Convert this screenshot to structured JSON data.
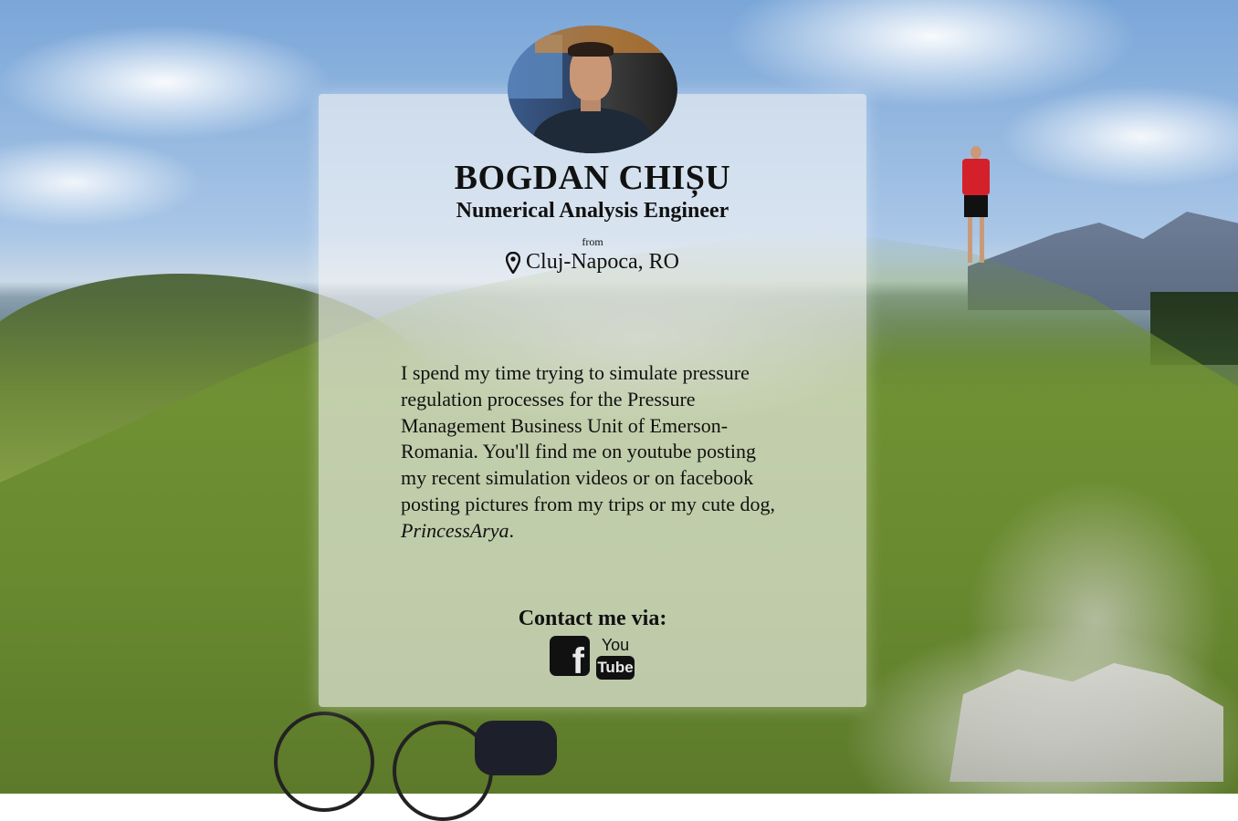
{
  "profile": {
    "name": "BOGDAN CHIȘU",
    "title": "Numerical Analysis Engineer",
    "from_label": "from",
    "location": "Cluj-Napoca, RO"
  },
  "bio": {
    "text": "I spend my time trying to simulate pressure regulation processes for the Pressure Management Business Unit of Emerson-Romania. You'll find me on youtube posting my recent simulation videos or on facebook posting pictures from my trips or my cute dog, ",
    "dog_name": "PrincessArya",
    "end": "."
  },
  "contact": {
    "heading": "Contact me via:",
    "facebook_icon": "facebook-icon",
    "youtube_icon": "youtube-icon",
    "youtube_top": "You",
    "youtube_bottom": "Tube",
    "facebook_glyph": "f"
  },
  "icons": {
    "location": "map-pin-icon"
  },
  "colors": {
    "card_background": "#f5f5f5",
    "text": "#111111"
  }
}
